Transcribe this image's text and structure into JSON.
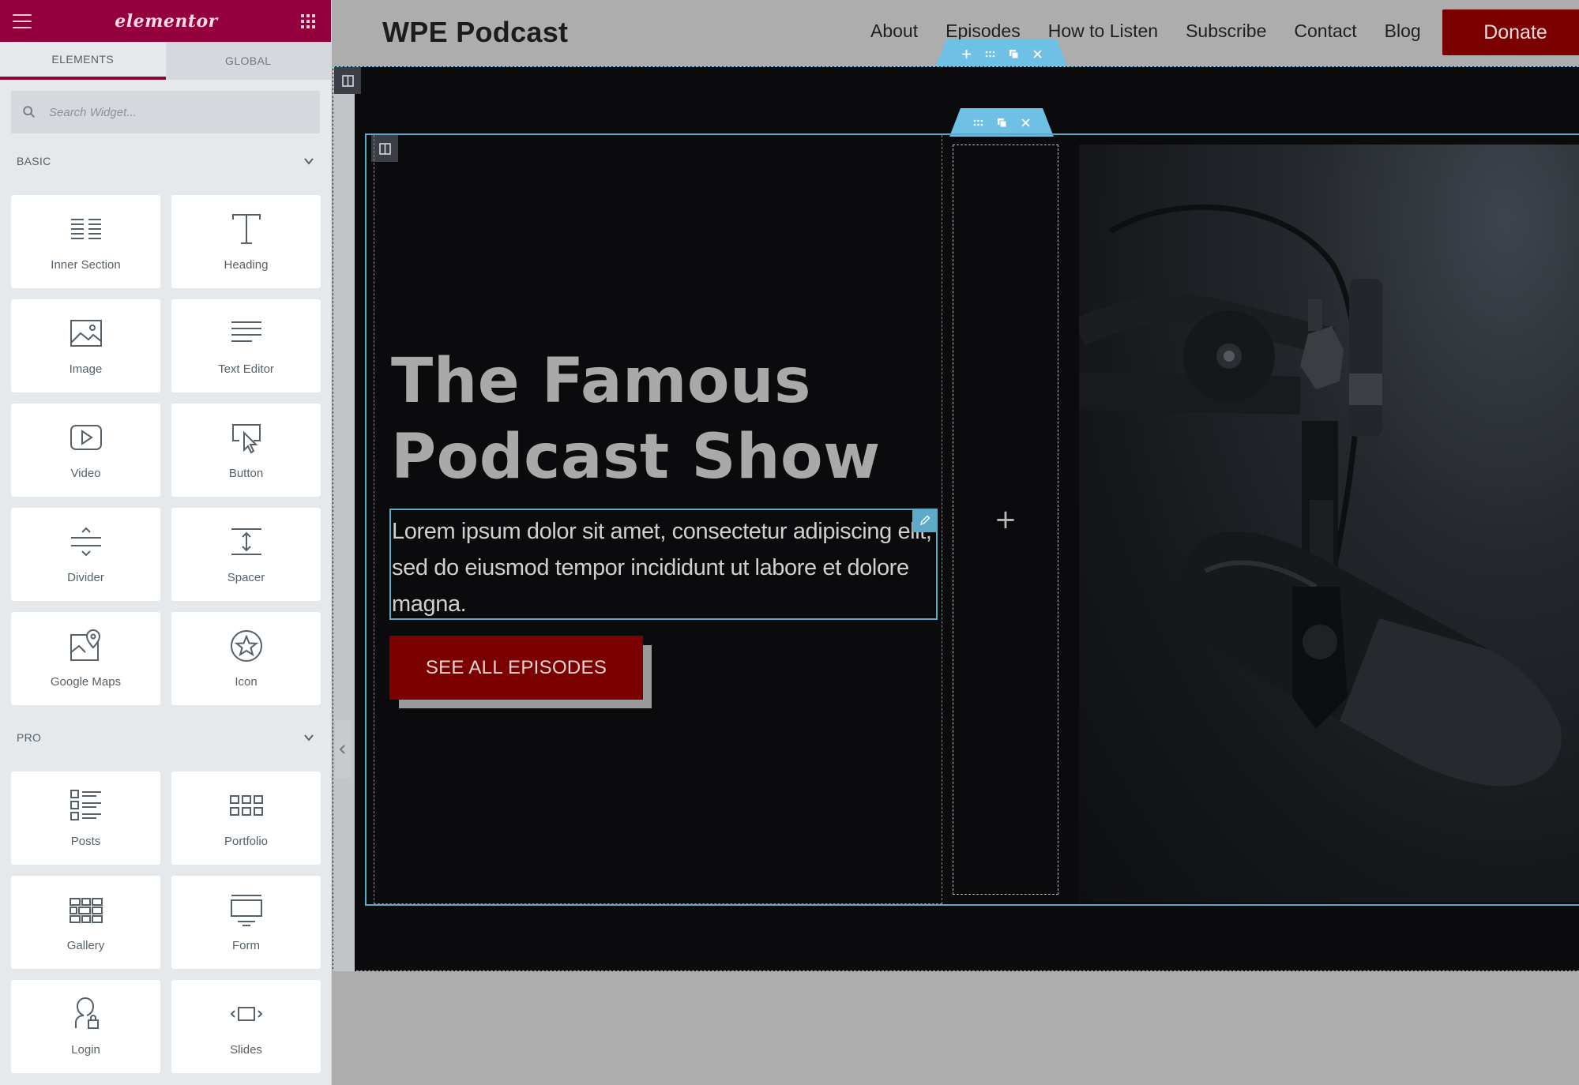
{
  "panel": {
    "brand": "elementor",
    "tabs": [
      "ELEMENTS",
      "GLOBAL"
    ],
    "search": {
      "placeholder": "Search Widget..."
    },
    "categories": [
      {
        "label": "BASIC",
        "widgets": [
          {
            "label": "Inner Section",
            "icon": "inner-section-icon"
          },
          {
            "label": "Heading",
            "icon": "heading-icon"
          },
          {
            "label": "Image",
            "icon": "image-icon"
          },
          {
            "label": "Text Editor",
            "icon": "text-editor-icon"
          },
          {
            "label": "Video",
            "icon": "video-icon"
          },
          {
            "label": "Button",
            "icon": "button-icon"
          },
          {
            "label": "Divider",
            "icon": "divider-icon"
          },
          {
            "label": "Spacer",
            "icon": "spacer-icon"
          },
          {
            "label": "Google Maps",
            "icon": "google-maps-icon"
          },
          {
            "label": "Icon",
            "icon": "star-icon"
          }
        ]
      },
      {
        "label": "PRO",
        "widgets": [
          {
            "label": "Posts",
            "icon": "posts-icon"
          },
          {
            "label": "Portfolio",
            "icon": "portfolio-icon"
          },
          {
            "label": "Gallery",
            "icon": "gallery-icon"
          },
          {
            "label": "Form",
            "icon": "form-icon"
          },
          {
            "label": "Login",
            "icon": "login-icon"
          },
          {
            "label": "Slides",
            "icon": "slides-icon"
          }
        ]
      }
    ]
  },
  "site": {
    "title": "WPE Podcast",
    "nav": [
      "About",
      "Episodes",
      "How to Listen",
      "Subscribe",
      "Contact",
      "Blog"
    ],
    "donate": "Donate"
  },
  "hero": {
    "title_line1": "The Famous",
    "title_line2": "Podcast Show",
    "text": "Lorem ipsum dolor sit amet, consectetur adipiscing elit, sed do eiusmod tempor incididunt ut labore et dolore magna.",
    "button": "SEE ALL EPISODES",
    "add_symbol": "+"
  },
  "colors": {
    "panel_header": "#93003c",
    "accent_blue": "#6ec1e4",
    "donate_bg": "#7b0000",
    "section_bg": "#0b0b0d"
  }
}
